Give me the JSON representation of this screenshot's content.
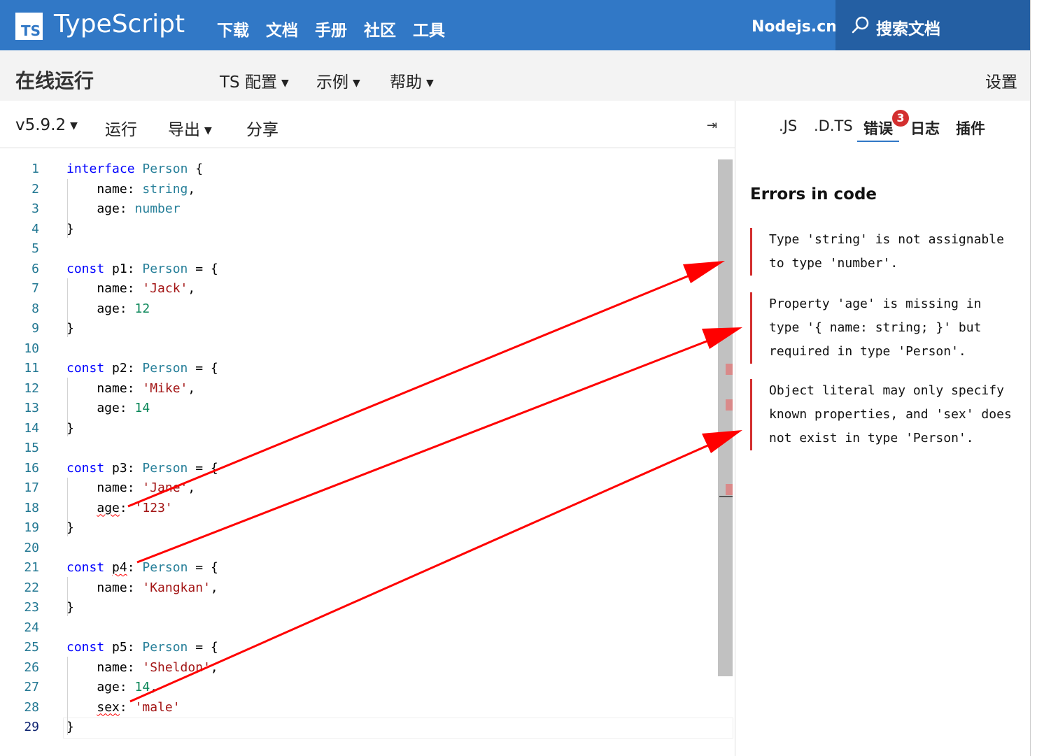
{
  "topnav": {
    "logo_text": "TS",
    "brand": "TypeScript",
    "links": [
      "下载",
      "文档",
      "手册",
      "社区",
      "工具"
    ],
    "nodejs": "Nodejs.cn",
    "search_label": "搜索文档"
  },
  "subnav": {
    "title": "在线运行",
    "menus": [
      "TS 配置",
      "示例",
      "帮助"
    ],
    "settings": "设置"
  },
  "toolbar": {
    "version": "v5.9.2",
    "run": "运行",
    "export": "导出",
    "share": "分享",
    "collapse_glyph": "⇥"
  },
  "right_tabs": {
    "tabs": [
      ".JS",
      ".D.TS",
      "错误",
      "日志",
      "插件"
    ],
    "active": "错误",
    "error_count": "3"
  },
  "errors": {
    "heading": "Errors in code",
    "items": [
      "Type 'string' is not assignable to type 'number'.",
      "Property 'age' is missing in type '{ name: string; }' but required in type 'Person'.",
      "Object literal may only specify known properties, and 'sex' does not exist in type 'Person'."
    ]
  },
  "code_lines": [
    "interface Person {",
    "    name: string,",
    "    age: number",
    "}",
    "",
    "const p1: Person = {",
    "    name: 'Jack',",
    "    age: 12",
    "}",
    "",
    "const p2: Person = {",
    "    name: 'Mike',",
    "    age: 14",
    "}",
    "",
    "const p3: Person = {",
    "    name: 'Jane',",
    "    age: '123'",
    "}",
    "",
    "const p4: Person = {",
    "    name: 'Kangkan',",
    "}",
    "",
    "const p5: Person = {",
    "    name: 'Sheldon',",
    "    age: 14,",
    "    sex: 'male'",
    "}"
  ],
  "colors": {
    "brand_blue": "#3178c6",
    "search_bg": "#245fa3",
    "error_red": "#d32f2f",
    "keyword": "#0000ff",
    "type": "#267f99",
    "string": "#a31515",
    "number": "#098658",
    "annotation_arrow": "#ff0000"
  }
}
